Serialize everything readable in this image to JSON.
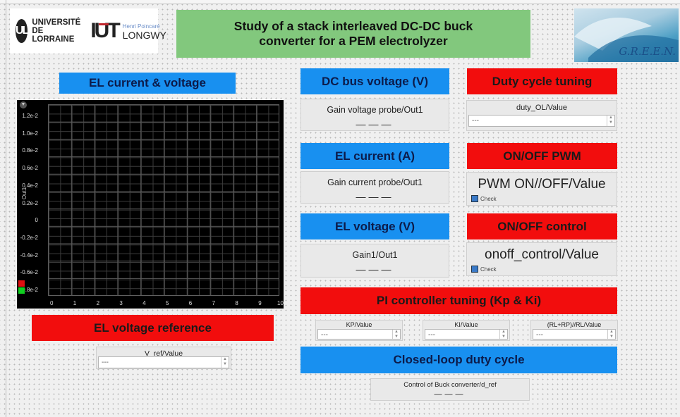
{
  "logo_univ": {
    "university_line1": "UNIVERSITÉ",
    "university_line2": "DE LORRAINE",
    "iut": "IUT",
    "henri": "Henri Poincaré",
    "longwy": "LONGWY"
  },
  "logo_green": {
    "text": "G.R.E.E.N."
  },
  "title": "Study of a stack interleaved DC-DC buck converter for a PEM electrolyzer",
  "left": {
    "scope_header": "EL current & voltage",
    "scope": {
      "ylabel": "Out1",
      "y_ticks": [
        "1.2e-2",
        "1.0e-2",
        "0.8e-2",
        "0.6e-2",
        "0.4e-2",
        "0.2e-2",
        "0",
        "-0.2e-2",
        "-0.4e-2",
        "-0.6e-2",
        "-0.8e-2"
      ],
      "x_ticks": [
        "0",
        "1",
        "2",
        "3",
        "4",
        "5",
        "6",
        "7",
        "8",
        "9",
        "10"
      ]
    },
    "vref_header": "EL voltage reference",
    "vref_control": {
      "label": "V_ref/Value",
      "value": "---"
    }
  },
  "mid": {
    "dcbus": {
      "header": "DC bus voltage (V)",
      "label": "Gain voltage probe/Out1",
      "value": "———"
    },
    "elcurrent": {
      "header": "EL current (A)",
      "label": "Gain current probe/Out1",
      "value": "———"
    },
    "elvoltage": {
      "header": "EL voltage (V)",
      "label": "Gain1/Out1",
      "value": "———"
    }
  },
  "right": {
    "duty": {
      "header": "Duty cycle tuning",
      "label": "duty_OL/Value",
      "value": "---"
    },
    "pwm": {
      "header": "ON/OFF PWM",
      "label": "PWM ON//OFF/Value",
      "check": "Check"
    },
    "onoff": {
      "header": "ON/OFF control",
      "label": "onoff_control/Value",
      "check": "Check"
    }
  },
  "pi": {
    "header": "PI controller tuning (Kp & Ki)",
    "kp": {
      "label": "KP/Value",
      "value": "---"
    },
    "ki": {
      "label": "KI/Value",
      "value": "---"
    },
    "rl": {
      "label": "(RL+RP)//RL/Value",
      "value": "---"
    }
  },
  "closed_loop": {
    "header": "Closed-loop duty cycle",
    "label": "Control of Buck converter/d_ref",
    "value": "———"
  },
  "colors": {
    "blue_header": "#1890f0",
    "red_header": "#f20d0d",
    "title_green": "#82c87d",
    "scope_bg": "#000000"
  }
}
